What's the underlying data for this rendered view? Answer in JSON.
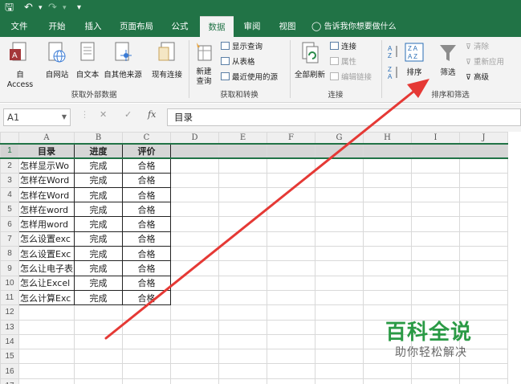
{
  "title_bar": {
    "save_glyph": "🖫",
    "undo_glyph": "↶",
    "redo_glyph": "↷",
    "customize_glyph": "▾"
  },
  "tabs": [
    {
      "label": "文件",
      "active": false
    },
    {
      "label": "开始",
      "active": false
    },
    {
      "label": "插入",
      "active": false
    },
    {
      "label": "页面布局",
      "active": false
    },
    {
      "label": "公式",
      "active": false
    },
    {
      "label": "数据",
      "active": true
    },
    {
      "label": "审阅",
      "active": false
    },
    {
      "label": "视图",
      "active": false
    }
  ],
  "tell_me": "告诉我你想要做什么",
  "ribbon": {
    "get_external": {
      "group_label": "获取外部数据",
      "from_access": "自 Access",
      "from_web": "自网站",
      "from_text": "自文本",
      "from_other": "自其他来源",
      "existing": "现有连接"
    },
    "get_transform": {
      "group_label": "获取和转换",
      "new_query_1": "新建",
      "new_query_2": "查询",
      "show_queries": "显示查询",
      "from_table": "从表格",
      "recent_sources": "最近使用的源"
    },
    "connections": {
      "group_label": "连接",
      "refresh_all": "全部刷新",
      "connections": "连接",
      "properties": "属性",
      "edit_links": "编辑链接"
    },
    "sort_filter": {
      "group_label": "排序和筛选",
      "sort": "排序",
      "filter": "筛选",
      "clear": "清除",
      "reapply": "重新应用",
      "advanced": "高级"
    }
  },
  "formula_bar": {
    "name_box": "A1",
    "cancel": "✕",
    "enter": "✓",
    "fx": "fx",
    "content": "目录"
  },
  "columns": [
    "A",
    "B",
    "C",
    "D",
    "E",
    "F",
    "G",
    "H",
    "I",
    "J"
  ],
  "rows": [
    {
      "n": "1",
      "a": "目录",
      "b": "进度",
      "c": "评价"
    },
    {
      "n": "2",
      "a": "怎样显示Wo",
      "b": "完成",
      "c": "合格"
    },
    {
      "n": "3",
      "a": "怎样在Word",
      "b": "完成",
      "c": "合格"
    },
    {
      "n": "4",
      "a": "怎样在Word",
      "b": "完成",
      "c": "合格"
    },
    {
      "n": "5",
      "a": "怎样在word",
      "b": "完成",
      "c": "合格"
    },
    {
      "n": "6",
      "a": "怎样用word",
      "b": "完成",
      "c": "合格"
    },
    {
      "n": "7",
      "a": "怎么设置exc",
      "b": "完成",
      "c": "合格"
    },
    {
      "n": "8",
      "a": "怎么设置Exc",
      "b": "完成",
      "c": "合格"
    },
    {
      "n": "9",
      "a": "怎么让电子表",
      "b": "完成",
      "c": "合格"
    },
    {
      "n": "10",
      "a": "怎么让Excel",
      "b": "完成",
      "c": "合格"
    },
    {
      "n": "11",
      "a": "怎么计算Exc",
      "b": "完成",
      "c": "合格"
    },
    {
      "n": "12",
      "a": "",
      "b": "",
      "c": ""
    },
    {
      "n": "13",
      "a": "",
      "b": "",
      "c": ""
    },
    {
      "n": "14",
      "a": "",
      "b": "",
      "c": ""
    },
    {
      "n": "15",
      "a": "",
      "b": "",
      "c": ""
    },
    {
      "n": "16",
      "a": "",
      "b": "",
      "c": ""
    },
    {
      "n": "17",
      "a": "",
      "b": "",
      "c": ""
    }
  ],
  "watermark": {
    "brand": "百科全说",
    "slogan": "助你轻松解决"
  },
  "colors": {
    "excel_green": "#217346",
    "arrow_red": "#e53935",
    "watermark_green": "#2a9a45"
  }
}
